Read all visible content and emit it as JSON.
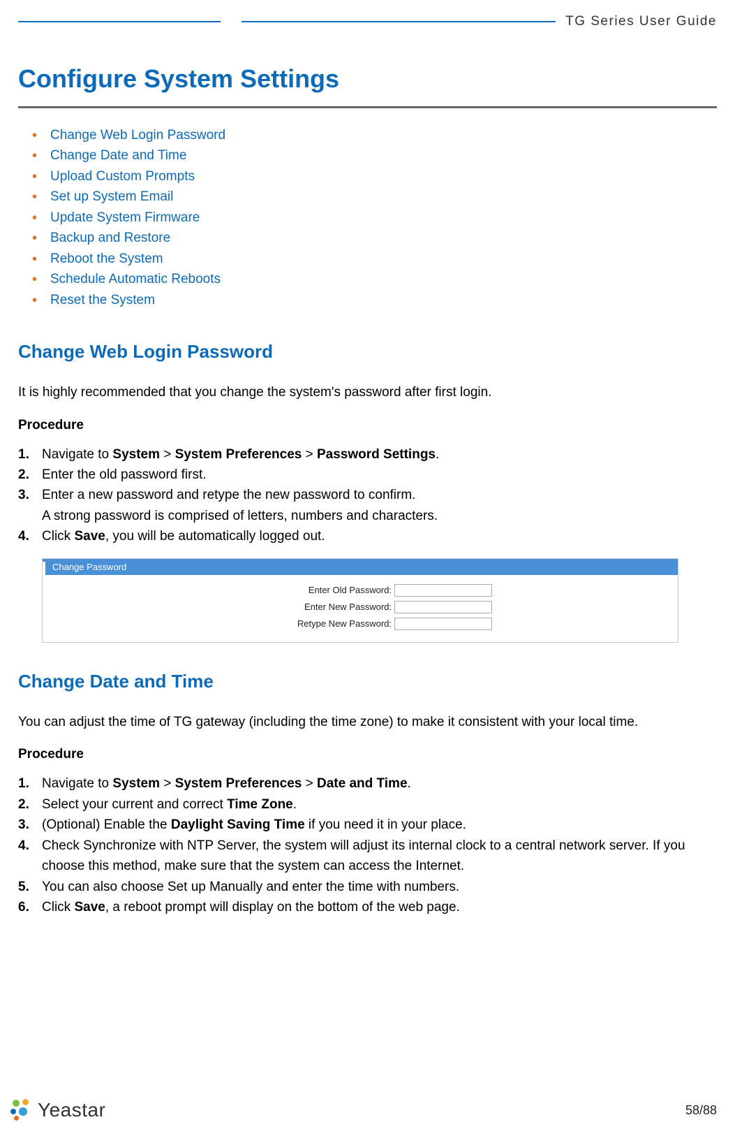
{
  "header": {
    "guide_title": "TG  Series  User  Guide"
  },
  "title": "Configure System Settings",
  "toc": [
    "Change Web Login Password",
    "Change Date and Time",
    "Upload Custom Prompts",
    "Set up System Email",
    "Update System Firmware",
    "Backup and Restore",
    "Reboot the System",
    "Schedule Automatic Reboots",
    "Reset the System"
  ],
  "section1": {
    "heading": "Change Web Login Password",
    "intro": "It is highly recommended that you change the system's password after first login.",
    "procedure_label": "Procedure",
    "steps": {
      "s1_pre": "Navigate to ",
      "s1_b1": "System",
      "s1_mid1": " > ",
      "s1_b2": "System Preferences",
      "s1_mid2": " > ",
      "s1_b3": "Password Settings",
      "s1_post": ".",
      "s2": "Enter the old password first.",
      "s3a": "Enter a new password and retype the new password to confirm.",
      "s3b": "A strong password is comprised of letters, numbers and characters.",
      "s4_pre": "Click ",
      "s4_b": "Save",
      "s4_post": ", you will be automatically logged out."
    },
    "panel": {
      "title": "Change Password",
      "old_label": "Enter Old Password:",
      "new_label": "Enter New Password:",
      "retype_label": "Retype New Password:"
    }
  },
  "section2": {
    "heading": "Change Date and Time",
    "intro": "You can adjust the time of TG gateway (including the time zone) to make it consistent with your local time.",
    "procedure_label": "Procedure",
    "steps": {
      "s1_pre": "Navigate to ",
      "s1_b1": "System",
      "s1_mid1": " > ",
      "s1_b2": "System Preferences",
      "s1_mid2": " > ",
      "s1_b3": "Date and Time",
      "s1_post": ".",
      "s2_pre": "Select your current and correct ",
      "s2_b": "Time Zone",
      "s2_post": ".",
      "s3_pre": "(Optional) Enable the ",
      "s3_b": "Daylight Saving Time",
      "s3_post": " if you need it in your place.",
      "s4": "Check Synchronize with NTP Server, the system will adjust its internal clock to a central network server. If you choose this method, make sure that the system can access the Internet.",
      "s5": "You can also choose Set up Manually  and enter the time with numbers.",
      "s6_pre": "Click ",
      "s6_b": "Save",
      "s6_post": ", a reboot prompt will display on the bottom of the web page."
    }
  },
  "footer": {
    "brand": "Yeastar",
    "page": "58/88"
  }
}
